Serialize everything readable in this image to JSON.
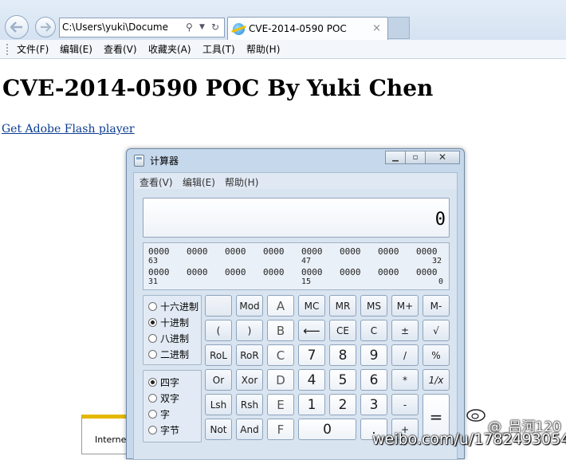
{
  "browser": {
    "address": "C:\\Users\\yuki\\Docume",
    "tab_title": "CVE-2014-0590 POC",
    "tab_close": "×",
    "menu": [
      "文件(F)",
      "编辑(E)",
      "查看(V)",
      "收藏夹(A)",
      "工具(T)",
      "帮助(H)"
    ]
  },
  "page": {
    "heading": "CVE-2014-0590 POC By Yuki Chen",
    "link": "Get Adobe Flash player",
    "popup_text": "Interne"
  },
  "calc": {
    "title": "计算器",
    "menu": [
      "查看(V)",
      "编辑(E)",
      "帮助(H)"
    ],
    "display": "0",
    "bits_row1": [
      "0000",
      "0000",
      "0000",
      "0000",
      "0000",
      "0000",
      "0000",
      "0000"
    ],
    "bits_row1_idx": [
      "63",
      "47",
      "32"
    ],
    "bits_row2": [
      "0000",
      "0000",
      "0000",
      "0000",
      "0000",
      "0000",
      "0000",
      "0000"
    ],
    "bits_row2_idx": [
      "31",
      "15",
      "0"
    ],
    "base_options": [
      "十六进制",
      "十进制",
      "八进制",
      "二进制"
    ],
    "base_selected": "十进制",
    "word_options": [
      "四字",
      "双字",
      "字",
      "字节"
    ],
    "word_selected": "四字",
    "keys": {
      "r1": [
        "",
        "Mod",
        "A",
        "MC",
        "MR",
        "MS",
        "M+",
        "M-"
      ],
      "r2": [
        "(",
        ")",
        "B",
        "⟵",
        "CE",
        "C",
        "±",
        "√"
      ],
      "r3": [
        "RoL",
        "RoR",
        "C",
        "7",
        "8",
        "9",
        "/",
        "%"
      ],
      "r4": [
        "Or",
        "Xor",
        "D",
        "4",
        "5",
        "6",
        "*",
        "1/x"
      ],
      "r5": [
        "Lsh",
        "Rsh",
        "E",
        "1",
        "2",
        "3",
        "-",
        "="
      ],
      "r6": [
        "Not",
        "And",
        "F",
        "0",
        ".",
        "+"
      ]
    }
  },
  "watermark": {
    "site": "weibo.com/u/1782493054",
    "handle": "@_吕河120"
  }
}
